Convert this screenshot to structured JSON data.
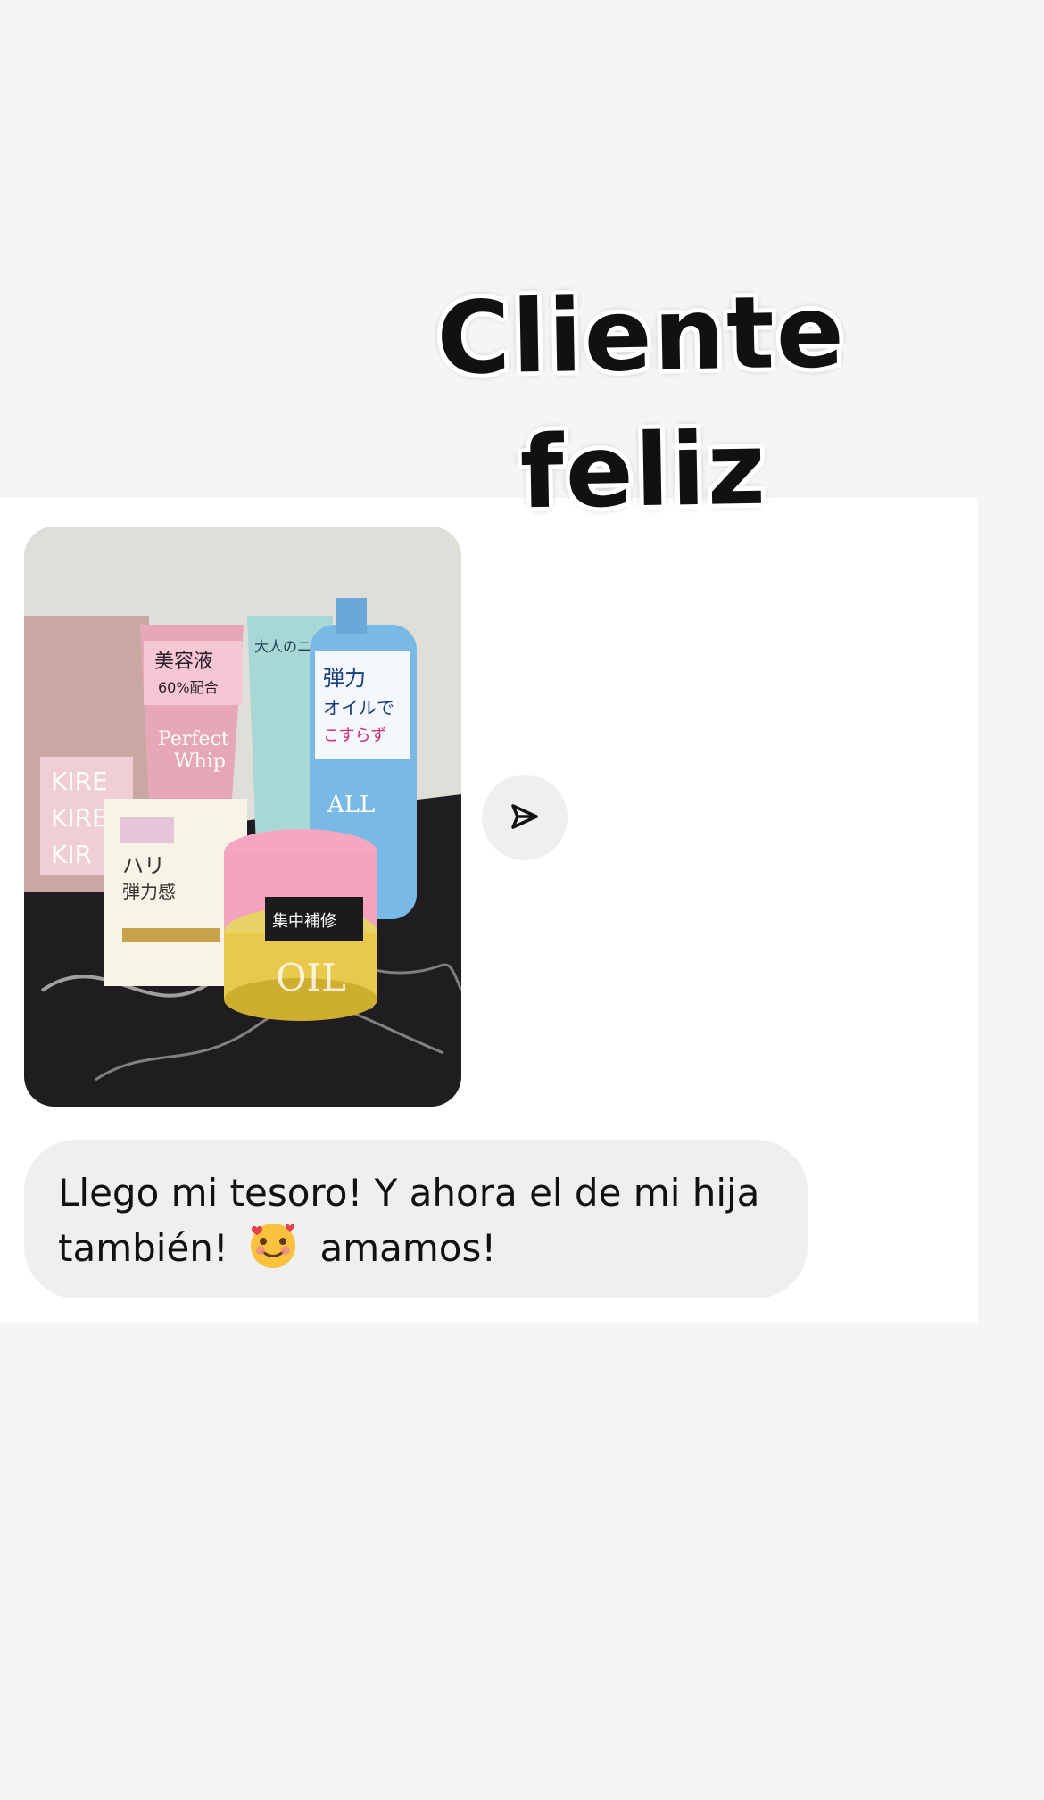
{
  "story": {
    "sticker": {
      "line1": "Cliente",
      "line2": "feliz"
    },
    "photo": {
      "icon": "product-photo",
      "box_label": "KIRE\nKIRE\nKIRE"
    },
    "share_button": {
      "icon": "send-icon"
    },
    "message": {
      "text_part1": "Llego mi tesoro! Y ahora el de mi hija también!",
      "emoji": "🥰",
      "text_part2": "amamos!"
    }
  },
  "colors": {
    "background": "#f5f5f5",
    "card": "#ffffff",
    "bubble": "#efefef",
    "text": "#111111"
  }
}
